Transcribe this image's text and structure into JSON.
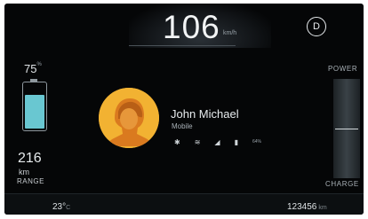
{
  "speed": {
    "value": "106",
    "unit": "km/h"
  },
  "gear": "D",
  "battery": {
    "percent": "75",
    "percent_sign": "%",
    "level": 0.75
  },
  "range": {
    "value": "216",
    "unit": "km",
    "label": "RANGE"
  },
  "contact": {
    "name": "John Michael",
    "subtitle": "Mobile",
    "status": {
      "bluetooth": "bluetooth-icon",
      "wifi": "wifi-icon",
      "signal": "signal-icon",
      "phone_battery": "64%"
    }
  },
  "power_gauge": {
    "top_label": "POWER",
    "bottom_label": "CHARGE"
  },
  "bottom_bar": {
    "temperature": "23°",
    "temperature_unit": "C",
    "odometer": "123456",
    "odometer_unit": "km"
  },
  "colors": {
    "battery_fill": "#69c7d1",
    "avatar_bg": "#f2b232"
  }
}
